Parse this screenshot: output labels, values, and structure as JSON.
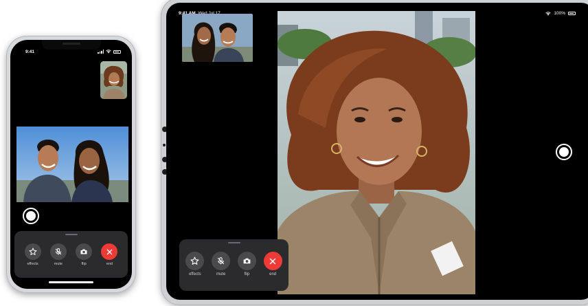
{
  "colors": {
    "end_button": "#ee3b37",
    "control_button": "#4a4a4d",
    "panel_bg": "#2b2b2d",
    "screen_bg": "#000000"
  },
  "iphone": {
    "status": {
      "time": "9:41"
    },
    "pip_icon": "self-view-woman-icon",
    "main_video_icon": "couple-video-icon",
    "controls": [
      {
        "id": "effects",
        "label": "effects",
        "icon": "star-icon"
      },
      {
        "id": "mute",
        "label": "mute",
        "icon": "microphone-slash-icon"
      },
      {
        "id": "flip",
        "label": "flip",
        "icon": "camera-flip-icon"
      },
      {
        "id": "end",
        "label": "end",
        "icon": "close-icon"
      }
    ]
  },
  "ipad": {
    "status": {
      "time": "9:41 AM",
      "date": "Wed Jul 17",
      "battery": "100%"
    },
    "controls": [
      {
        "id": "effects",
        "label": "effects",
        "icon": "star-icon"
      },
      {
        "id": "mute",
        "label": "mute",
        "icon": "microphone-slash-icon"
      },
      {
        "id": "flip",
        "label": "flip",
        "icon": "camera-flip-icon"
      },
      {
        "id": "end",
        "label": "end",
        "icon": "close-icon"
      }
    ]
  }
}
